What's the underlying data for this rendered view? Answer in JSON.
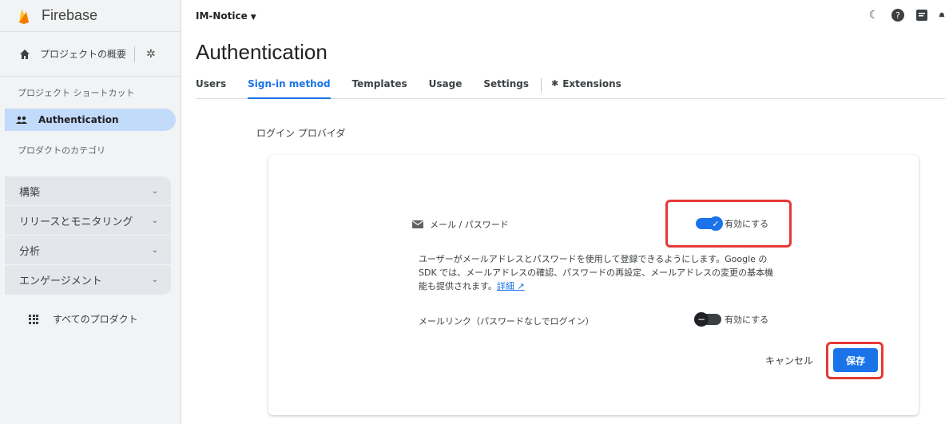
{
  "brand": {
    "name": "Firebase"
  },
  "sidebar": {
    "project_overview": "プロジェクトの概要",
    "shortcuts_title": "プロジェクト ショートカット",
    "active_item": "Authentication",
    "categories_title": "プロダクトのカテゴリ",
    "groups": [
      {
        "label": "構築"
      },
      {
        "label": "リリースとモニタリング"
      },
      {
        "label": "分析"
      },
      {
        "label": "エンゲージメント"
      }
    ],
    "all_products": "すべてのプロダクト"
  },
  "header": {
    "project": "IM-Notice",
    "title": "Authentication",
    "tabs": [
      {
        "label": "Users"
      },
      {
        "label": "Sign-in method"
      },
      {
        "label": "Templates"
      },
      {
        "label": "Usage"
      },
      {
        "label": "Settings"
      },
      {
        "label": "Extensions"
      }
    ]
  },
  "providers": {
    "title": "ログイン プロバイダ",
    "email_password": {
      "label": "メール / パスワード",
      "toggle_label": "有効にする",
      "enabled": true,
      "description": "ユーザーがメールアドレスとパスワードを使用して登録できるようにします。Google の SDK では、メールアドレスの確認、パスワードの再設定、メールアドレスの変更の基本機能も提供されます。",
      "link_label": "詳細"
    },
    "email_link": {
      "label": "メールリンク（パスワードなしでログイン）",
      "toggle_label": "有効にする",
      "enabled": false
    },
    "cancel_label": "キャンセル",
    "save_label": "保存"
  },
  "colors": {
    "accent": "#1a73e8",
    "highlight": "#e53935"
  },
  "icons": [
    "flame-icon",
    "home-icon",
    "gear-icon",
    "people-icon",
    "chevron-down-icon",
    "grid-icon",
    "moon-icon",
    "help-icon",
    "notes-icon",
    "mail-icon",
    "check-icon",
    "external-link-icon",
    "extensions-icon"
  ]
}
